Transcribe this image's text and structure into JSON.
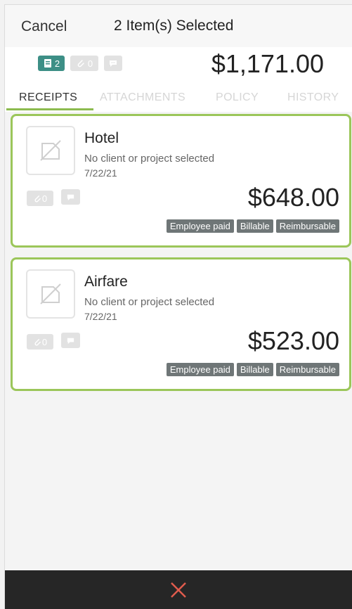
{
  "header": {
    "cancel_label": "Cancel",
    "title": "2 Item(s) Selected"
  },
  "summary": {
    "receipts_count": "2",
    "attachments_count": "0",
    "total": "$1,171.00"
  },
  "tabs": [
    {
      "label": "RECEIPTS",
      "active": true
    },
    {
      "label": "ATTACHMENTS",
      "active": false
    },
    {
      "label": "POLICY",
      "active": false
    },
    {
      "label": "HISTORY",
      "active": false
    }
  ],
  "cards": [
    {
      "title": "Hotel",
      "subtitle": "No client or project selected",
      "date": "7/22/21",
      "attachments_count": "0",
      "amount": "$648.00",
      "tags": [
        "Employee paid",
        "Billable",
        "Reimbursable"
      ]
    },
    {
      "title": "Airfare",
      "subtitle": "No client or project selected",
      "date": "7/22/21",
      "attachments_count": "0",
      "amount": "$523.00",
      "tags": [
        "Employee paid",
        "Billable",
        "Reimbursable"
      ]
    }
  ],
  "colors": {
    "accent_green": "#9bc65a",
    "teal_badge": "#3d8f86",
    "close_red": "#e05c4d",
    "tag_gray": "#6f7677"
  },
  "icons": {
    "receipt": "receipt-icon",
    "attachment": "paperclip-icon",
    "comment": "comment-icon",
    "no_image": "no-image-icon",
    "close": "close-icon"
  }
}
